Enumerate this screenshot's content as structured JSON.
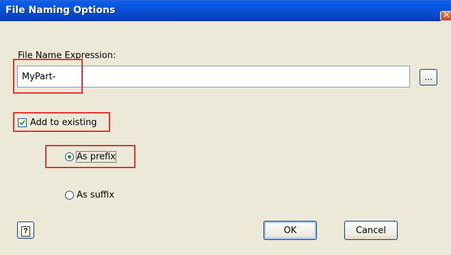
{
  "window": {
    "title": "File Naming Options",
    "close_glyph": "✕"
  },
  "expression": {
    "label": "File Name Expression:",
    "value": "MyPart-",
    "browse_label": "..."
  },
  "add_to_existing": {
    "label": "Add to existing",
    "checked": true
  },
  "position": {
    "prefix_label": "As prefix",
    "suffix_label": "As suffix",
    "selected": "prefix"
  },
  "footer": {
    "help_glyph": "?",
    "ok_label": "OK",
    "cancel_label": "Cancel"
  },
  "colors": {
    "title_bar": "#0a4fd6",
    "highlight": "#e23030",
    "dialog_bg": "#ECE9D8"
  }
}
